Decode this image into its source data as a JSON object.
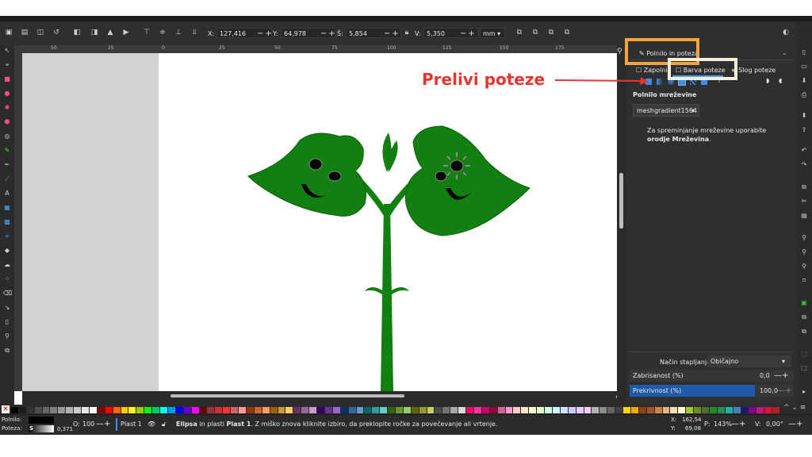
{
  "toolbar": {
    "x_label": "X:",
    "x_value": "127,416",
    "y_label": "Y:",
    "y_value": "64,978",
    "w_label": "Š:",
    "w_value": "5,854",
    "h_label": "V:",
    "h_value": "5,350",
    "unit": "mm"
  },
  "ruler_ticks": [
    "50",
    "25",
    "0",
    "25",
    "50",
    "75",
    "100",
    "125",
    "150",
    "175"
  ],
  "panel": {
    "tab_label": "Polnilo in poteza",
    "subtab_fill": "Zapolni",
    "subtab_stroke": "Barva poteze",
    "subtab_style": "Slog poteze",
    "section_title": "Polnilo mreževine",
    "mesh_name": "meshgradient1564",
    "hint_text": "Za spreminjanje mreževine uporabite",
    "hint_bold": "orodje Mreževina",
    "hint_dot": ".",
    "blend_label": "Način stapljanja:",
    "blend_value": "Običajno",
    "blur_label": "Zabrisanost (%)",
    "blur_value": "0,0",
    "opacity_label": "Prekrivnost (%)",
    "opacity_value": "100,0"
  },
  "annotation": {
    "label": "Prelivi poteze",
    "color": "#e8342e",
    "box_orange": "#f4a53a",
    "box_cream": "#f5f0dc"
  },
  "status": {
    "fill_label": "Polnilo:",
    "stroke_label": "Poteza:",
    "stroke_letter": "S",
    "stroke_width": "0,371",
    "opacity_letter": "O:",
    "opacity_value": "100",
    "layer": "Plast 1",
    "message_bold": "Elipsa",
    "message_mid": " in plasti ",
    "message_layer": "Plast 1",
    "message_rest": ". Z miško znova kliknite izbiro, da preklopite ročke za povečevanje ali vrtenje.",
    "x_label": "X:",
    "x_value": "162,54",
    "y_label": "Y:",
    "y_value": "69,08",
    "zoom_label": "P:",
    "zoom_value": "143%",
    "rot_label": "V:",
    "rot_value": "0,00°"
  },
  "colors": {
    "leaf": "#118011",
    "leaf_stroke": "#0b5e0b",
    "highlight_blue": "#1e5aa8"
  }
}
